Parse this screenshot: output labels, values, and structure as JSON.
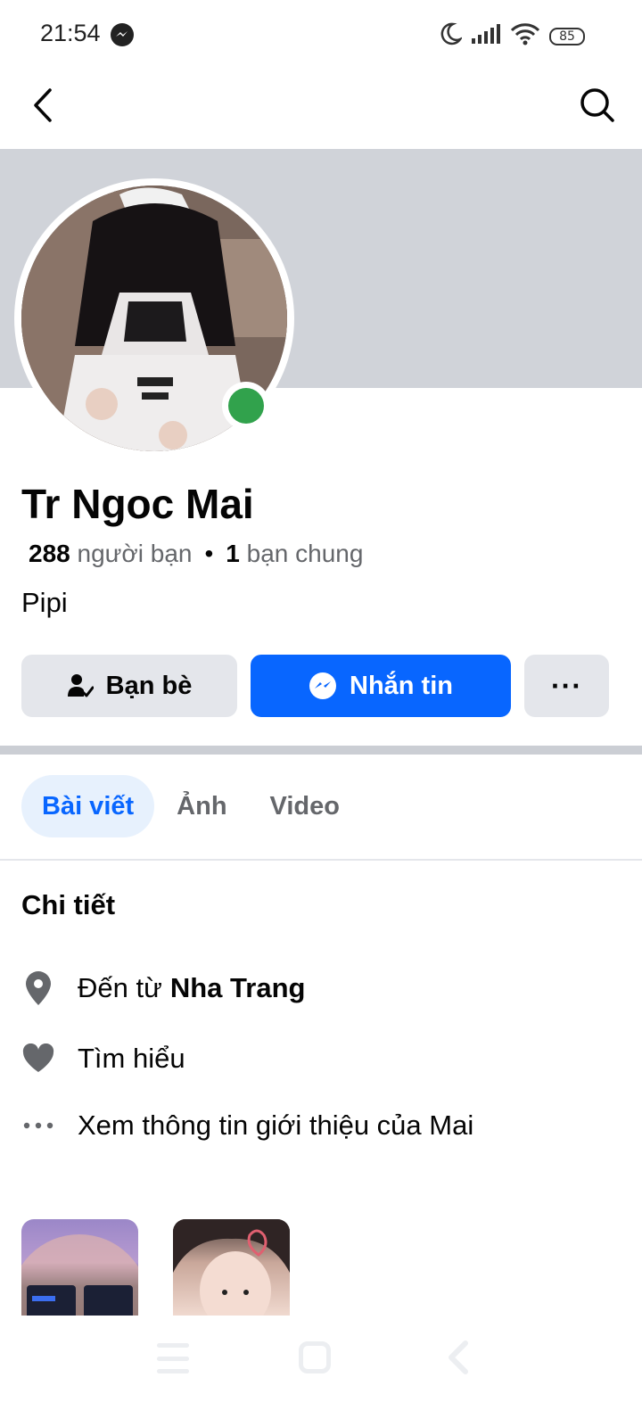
{
  "status_bar": {
    "time": "21:54",
    "battery": "85",
    "icons": [
      "messenger-icon",
      "moon-icon",
      "signal-icon",
      "wifi-icon",
      "battery-icon"
    ]
  },
  "top_nav": {
    "icons": [
      "back-arrow-icon",
      "search-icon"
    ]
  },
  "profile": {
    "name": "Tr Ngoc Mai",
    "friends_count": "288",
    "friends_label": "người bạn",
    "separator": "•",
    "mutual_count": "1",
    "mutual_label": "bạn chung",
    "bio": "Pipi",
    "online": true,
    "online_color": "#31a24c"
  },
  "actions": {
    "friends_label": "Bạn bè",
    "message_label": "Nhắn tin",
    "more_label": "···",
    "primary_color": "#0866ff"
  },
  "tabs": [
    {
      "label": "Bài viết",
      "active": true
    },
    {
      "label": "Ảnh",
      "active": false
    },
    {
      "label": "Video",
      "active": false
    }
  ],
  "details": {
    "title": "Chi tiết",
    "from_prefix": "Đến từ",
    "from_place": "Nha Trang",
    "looking_for": "Tìm hiểu",
    "see_about": "Xem thông tin giới thiệu của Mai"
  },
  "bottom_nav": {
    "icons": [
      "menu-icon",
      "home-icon",
      "back-icon"
    ]
  }
}
